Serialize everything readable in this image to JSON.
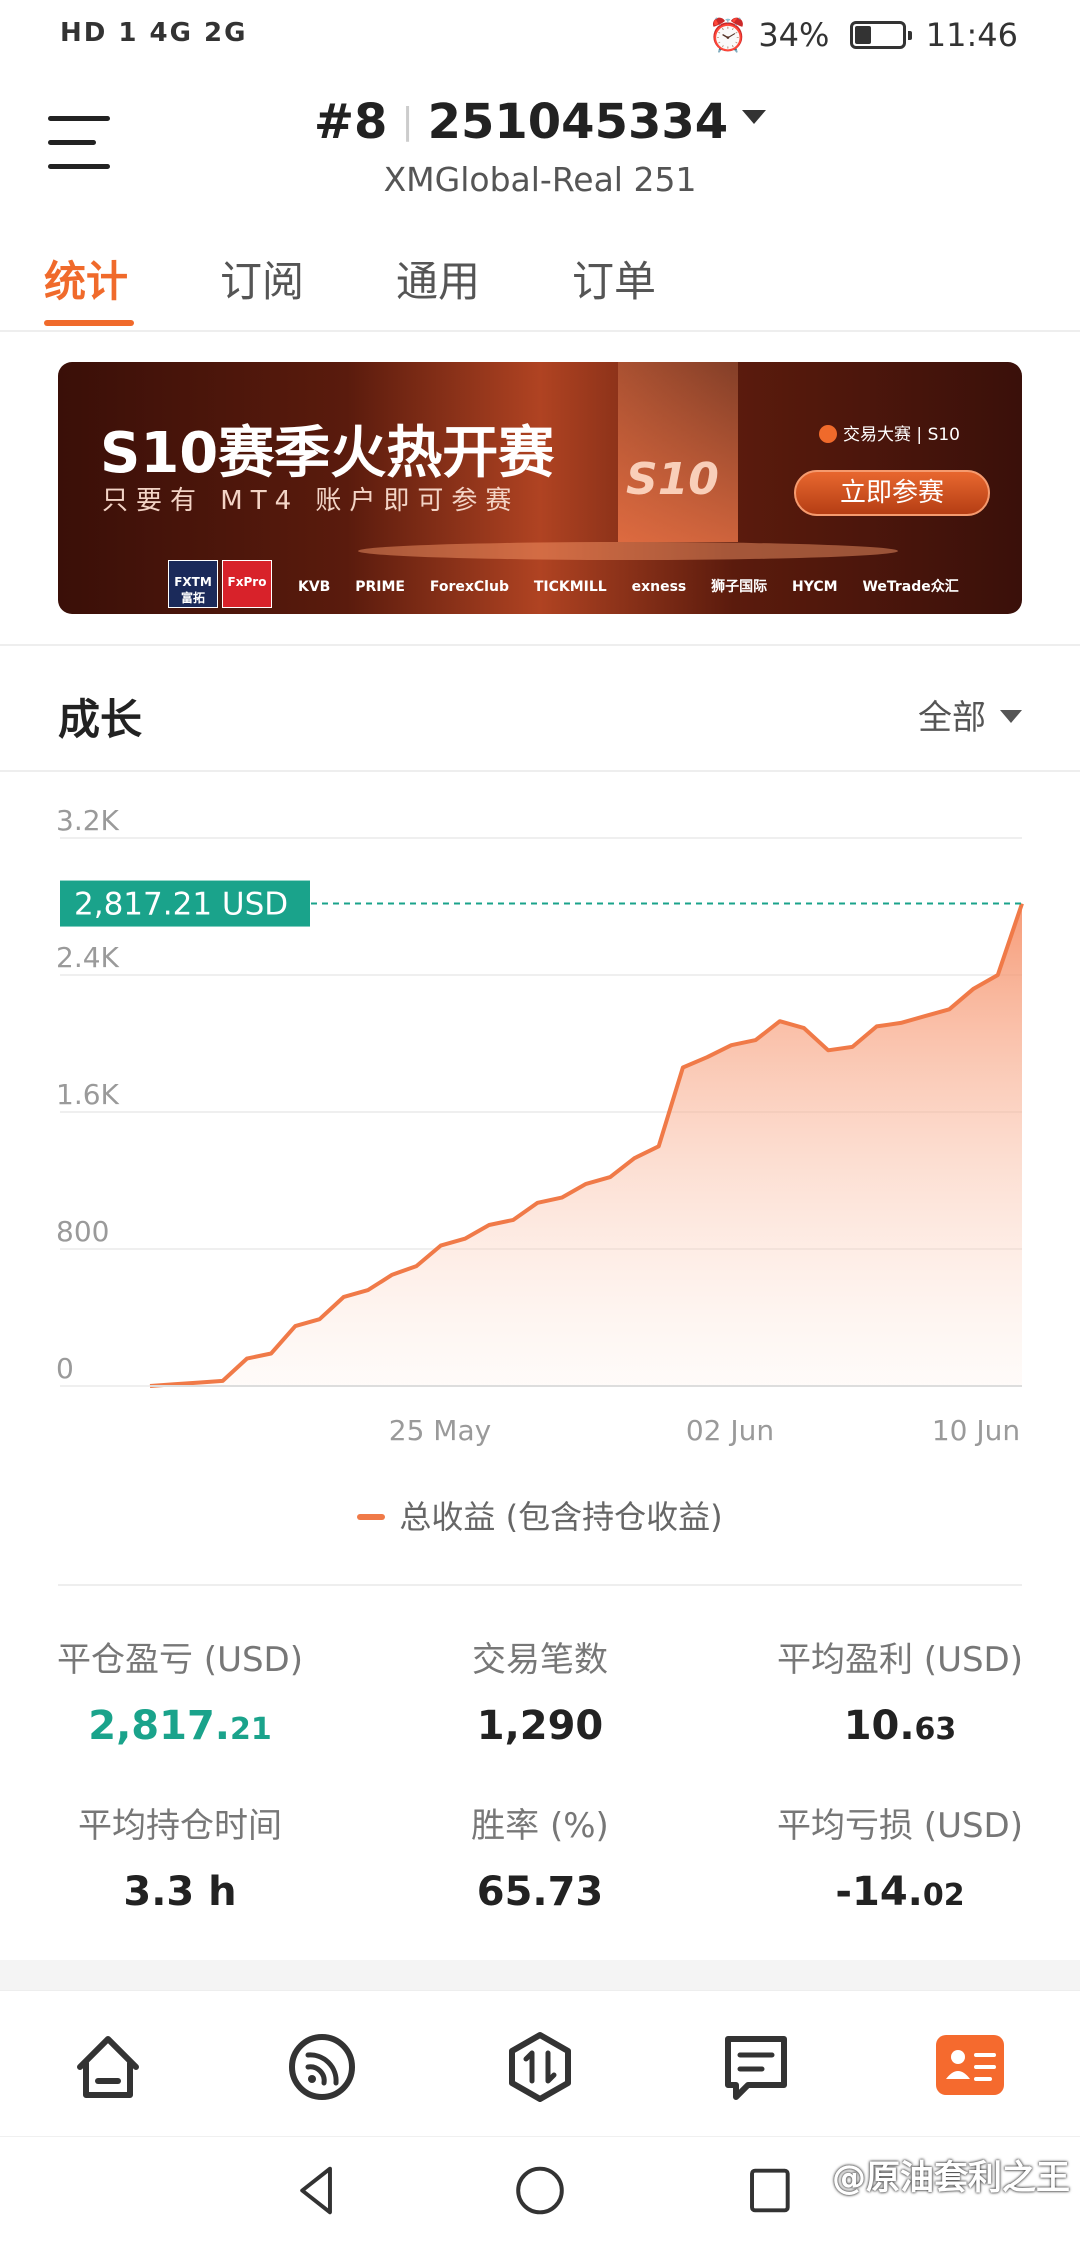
{
  "status_bar": {
    "left": "HD 1  4G  2G",
    "battery": "34%",
    "time": "11:46"
  },
  "header": {
    "rank": "#8",
    "account": "251045334",
    "server": "XMGlobal-Real 251"
  },
  "tabs": [
    {
      "label": "统计",
      "active": true
    },
    {
      "label": "订阅",
      "active": false
    },
    {
      "label": "通用",
      "active": false
    },
    {
      "label": "订单",
      "active": false
    }
  ],
  "banner": {
    "title": "S10赛季火热开赛",
    "subtitle": "只要有 MT4 账户即可参赛",
    "badge": "S10",
    "event": "交易大赛 | S10",
    "cta": "立即参赛",
    "logos": [
      "FXTM 富拓",
      "FxPro",
      "KVB PRIME",
      "ForexClub",
      "TICKMILL",
      "exness",
      "狮子国际",
      "HYCM",
      "WeTrade众汇"
    ]
  },
  "growth": {
    "title": "成长",
    "range": "全部"
  },
  "chart_data": {
    "type": "area",
    "current_label": "2,817.21 USD",
    "current_value": 2817.21,
    "yticks": [
      "3.2K",
      "2.4K",
      "1.6K",
      "800",
      "0"
    ],
    "ylim": [
      0,
      3200
    ],
    "xticks": [
      "25 May",
      "02 Jun",
      "10 Jun"
    ],
    "series": [
      {
        "name": "总收益 (包含持仓收益)",
        "color": "#f07a48",
        "values": [
          0,
          10,
          20,
          30,
          160,
          190,
          350,
          390,
          520,
          560,
          650,
          700,
          820,
          860,
          940,
          970,
          1070,
          1100,
          1180,
          1220,
          1330,
          1400,
          1860,
          1920,
          1990,
          2020,
          2130,
          2090,
          1960,
          1980,
          2100,
          2120,
          2160,
          2200,
          2320,
          2400,
          2817.21
        ]
      }
    ]
  },
  "stats": [
    {
      "label": "平仓盈亏 (USD)",
      "int": "2,817.",
      "dec": "21",
      "green": true
    },
    {
      "label": "交易笔数",
      "int": "1,290",
      "dec": "",
      "green": false
    },
    {
      "label": "平均盈利 (USD)",
      "int": "10.",
      "dec": "63",
      "green": false
    },
    {
      "label": "平均持仓时间",
      "int": "3.3 h",
      "dec": "",
      "green": false
    },
    {
      "label": "胜率 (%)",
      "int": "65.73",
      "dec": "",
      "green": false
    },
    {
      "label": "平均亏损 (USD)",
      "int": "-14.",
      "dec": "02",
      "green": false
    }
  ],
  "bottom_nav": [
    {
      "icon": "home-icon"
    },
    {
      "icon": "feed-icon"
    },
    {
      "icon": "trade-icon"
    },
    {
      "icon": "message-icon"
    },
    {
      "icon": "profile-card-icon"
    }
  ],
  "watermark": "@原油套利之王"
}
